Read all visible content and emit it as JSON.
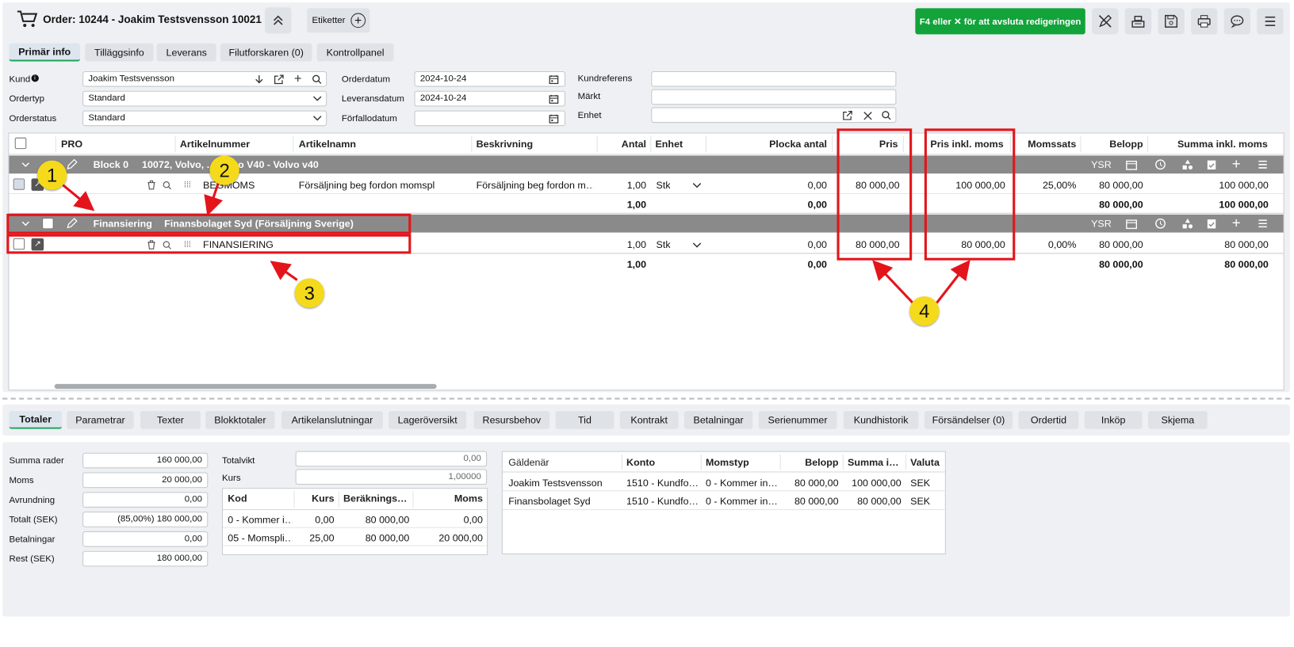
{
  "header": {
    "title": "Order: 10244 - Joakim Testsvensson 10021",
    "etiketter": "Etiketter",
    "edit_button": "F4 eller ✕ för att avsluta redigeringen"
  },
  "tabs": [
    "Primär info",
    "Tilläggsinfo",
    "Leverans",
    "Filutforskaren (0)",
    "Kontrollpanel"
  ],
  "form": {
    "kund_label": "Kund",
    "kund_value": "Joakim Testsvensson",
    "ordertyp_label": "Ordertyp",
    "ordertyp_value": "Standard",
    "orderstatus_label": "Orderstatus",
    "orderstatus_value": "Standard",
    "orderdatum_label": "Orderdatum",
    "orderdatum_value": "2024-10-24",
    "leveransdatum_label": "Leveransdatum",
    "leveransdatum_value": "2024-10-24",
    "forfallodatum_label": "Förfallodatum",
    "forfallodatum_value": "",
    "kundreferens_label": "Kundreferens",
    "kundreferens_value": "",
    "markt_label": "Märkt",
    "markt_value": "",
    "enhet_label": "Enhet",
    "enhet_value": ""
  },
  "grid": {
    "columns": [
      "PRO",
      "Artikelnummer",
      "Artikelnamn",
      "Beskrivning",
      "Antal",
      "Enhet",
      "Plocka antal",
      "Pris",
      "Pris inkl. moms",
      "Momssats",
      "Belopp",
      "Summa inkl. moms"
    ],
    "block_tools": "YSR",
    "block1": {
      "name": "Block 0",
      "info": "10072, Volvo, ... Volvo V40 - Volvo v40",
      "row": {
        "artikelnummer": "BEGMOMS",
        "artikelnamn": "Försäljning beg fordon momspl",
        "beskrivning": "Försäljning beg fordon m…",
        "antal": "1,00",
        "enhet": "Stk",
        "plocka": "0,00",
        "pris": "80 000,00",
        "pris_inkl": "100 000,00",
        "momssats": "25,00%",
        "belopp": "80 000,00",
        "summa": "100 000,00"
      },
      "sum": {
        "antal": "1,00",
        "plocka": "0,00",
        "belopp": "80 000,00",
        "summa": "100 000,00"
      }
    },
    "block2": {
      "name": "Finansiering",
      "info": "Finansbolaget Syd (Försäljning Sverige)",
      "row": {
        "artikelnummer": "FINANSIERING",
        "artikelnamn": "",
        "beskrivning": "",
        "antal": "1,00",
        "enhet": "Stk",
        "plocka": "0,00",
        "pris": "80 000,00",
        "pris_inkl": "80 000,00",
        "momssats": "0,00%",
        "belopp": "80 000,00",
        "summa": "80 000,00"
      },
      "sum": {
        "antal": "1,00",
        "plocka": "0,00",
        "belopp": "80 000,00",
        "summa": "80 000,00"
      }
    }
  },
  "markers": {
    "m1": "1",
    "m2": "2",
    "m3": "3",
    "m4": "4"
  },
  "bottom_tabs": [
    "Totaler",
    "Parametrar",
    "Texter",
    "Blokktotaler",
    "Artikelanslutningar",
    "Lageröversikt",
    "Resursbehov",
    "Tid",
    "Kontrakt",
    "Betalningar",
    "Serienummer",
    "Kundhistorik",
    "Försändelser (0)",
    "Ordertid",
    "Inköp",
    "Skjema"
  ],
  "totals": [
    {
      "label": "Summa rader",
      "value": "160 000,00"
    },
    {
      "label": "Moms",
      "value": "20 000,00"
    },
    {
      "label": "Avrundning",
      "value": "0,00"
    },
    {
      "label": "Totalt (SEK)",
      "value": "(85,00%) 180 000,00"
    },
    {
      "label": "Betalningar",
      "value": "0,00"
    },
    {
      "label": "Rest (SEK)",
      "value": "180 000,00"
    }
  ],
  "weight": {
    "totalvikt_label": "Totalvikt",
    "totalvikt_value": "0,00",
    "kurs_label": "Kurs",
    "kurs_value": "1,00000"
  },
  "vat_table": {
    "headers": [
      "Kod",
      "Kurs",
      "Beräknings…",
      "Moms"
    ],
    "rows": [
      [
        "0 - Kommer i…",
        "0,00",
        "80 000,00",
        "0,00"
      ],
      [
        "05 - Momspli…",
        "25,00",
        "80 000,00",
        "20 000,00"
      ]
    ]
  },
  "debtor_table": {
    "headers": [
      "Gäldenär",
      "Konto",
      "Momstyp",
      "Belopp",
      "Summa i…",
      "Valuta"
    ],
    "rows": [
      [
        "Joakim Testsvensson",
        "1510 - Kundfo…",
        "0 - Kommer in…",
        "80 000,00",
        "100 000,00",
        "SEK"
      ],
      [
        "Finansbolaget Syd",
        "1510 - Kundfo…",
        "0 - Kommer in…",
        "80 000,00",
        "80 000,00",
        "SEK"
      ]
    ]
  }
}
